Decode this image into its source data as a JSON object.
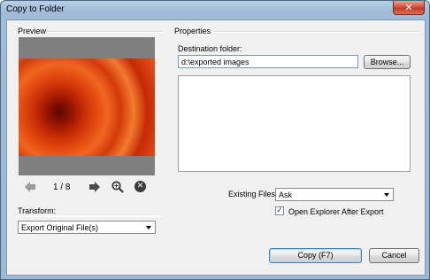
{
  "window": {
    "title": "Copy to Folder",
    "close_glyph": "✕"
  },
  "preview": {
    "group_label": "Preview",
    "counter": "1 / 8",
    "stop_glyph": "✕"
  },
  "transform": {
    "label": "Transform:",
    "selected": "Export Original File(s)"
  },
  "properties": {
    "group_label": "Properties",
    "destination_label": "Destination folder:",
    "destination_value": "d:\\exported images",
    "browse_label": "Browse...",
    "existing_files_label": "Existing Files:",
    "existing_files_selected": "Ask",
    "open_explorer_label": "Open Explorer After Export",
    "open_explorer_checked": true,
    "check_glyph": "✓"
  },
  "buttons": {
    "copy_label": "Copy (F7)",
    "cancel_label": "Cancel"
  },
  "colors": {
    "title_bar": "#a9c2dc",
    "client_bg": "#f0f0f0",
    "close_red": "#c23a25",
    "flower_orange": "#e34a10"
  },
  "icons": [
    "back-arrow-icon",
    "forward-arrow-icon",
    "zoom-icon",
    "stop-icon",
    "close-icon",
    "chevron-down-icon",
    "check-icon"
  ]
}
